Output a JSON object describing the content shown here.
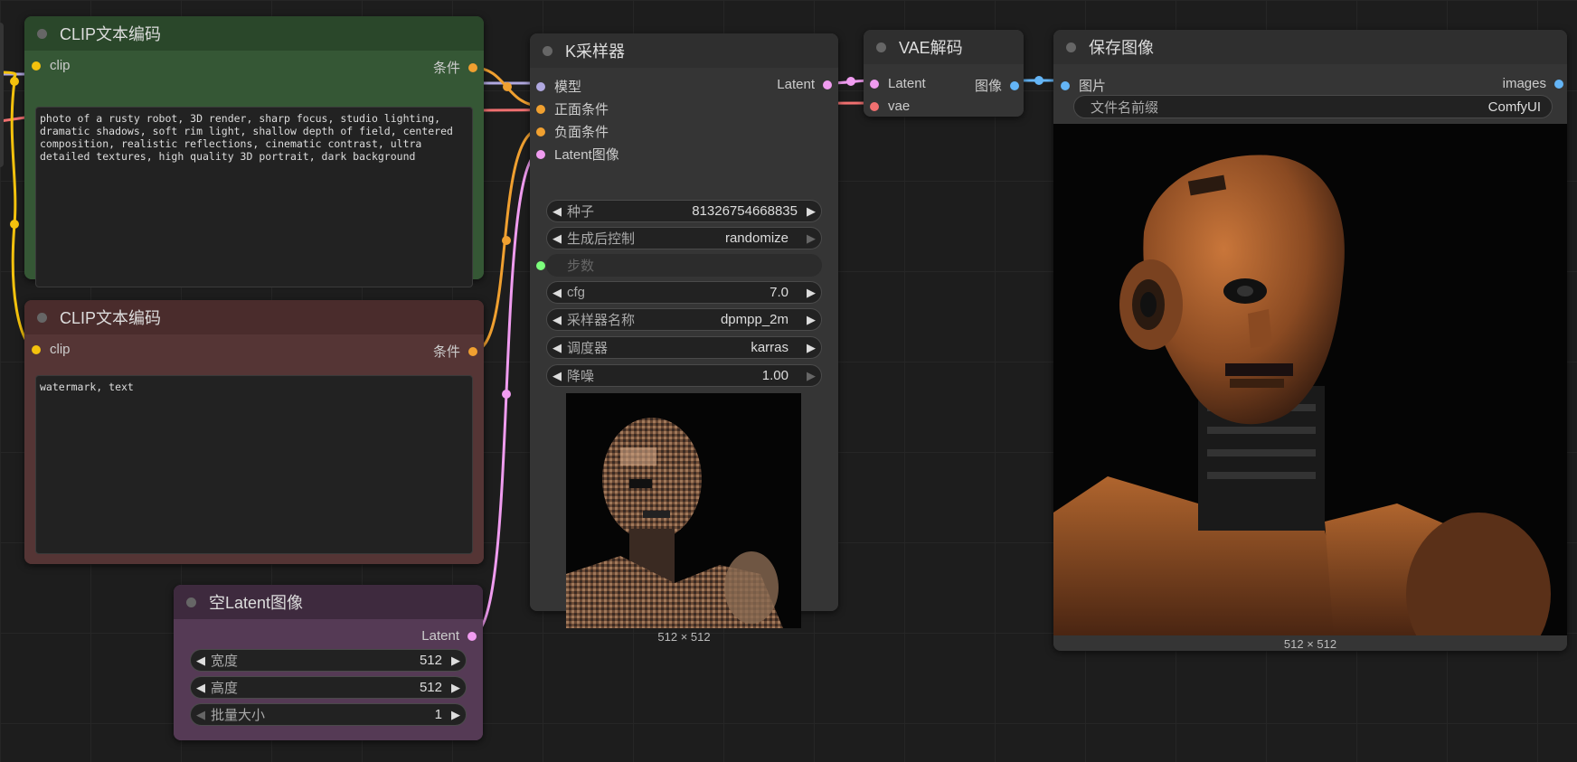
{
  "colors": {
    "clip_pin": "#f4c20d",
    "cond_pin": "#f0a030",
    "latent_pin": "#f09cf0",
    "model_pin": "#b0a8e0",
    "vae_pin": "#f07070",
    "image_pin": "#64b5f6",
    "int_pin": "#7cff7c"
  },
  "clip_pos": {
    "title": "CLIP文本编码",
    "input_clip": "clip",
    "output_cond": "条件",
    "text": "photo of a rusty robot, 3D render, sharp focus, studio lighting,\ndramatic shadows, soft rim light, shallow depth of field, centered\ncomposition, realistic reflections, cinematic contrast, ultra\ndetailed textures, high quality 3D portrait, dark background"
  },
  "clip_neg": {
    "title": "CLIP文本编码",
    "input_clip": "clip",
    "output_cond": "条件",
    "text": "watermark, text"
  },
  "empty_latent": {
    "title": "空Latent图像",
    "output_latent": "Latent",
    "width_label": "宽度",
    "width_value": "512",
    "height_label": "高度",
    "height_value": "512",
    "batch_label": "批量大小",
    "batch_value": "1"
  },
  "ksampler": {
    "title": "K采样器",
    "input_model": "模型",
    "input_positive": "正面条件",
    "input_negative": "负面条件",
    "input_latent": "Latent图像",
    "output_latent": "Latent",
    "seed_label": "种子",
    "seed_value": "81326754668835",
    "control_label": "生成后控制",
    "control_value": "randomize",
    "steps_label": "步数",
    "cfg_label": "cfg",
    "cfg_value": "7.0",
    "sampler_label": "采样器名称",
    "sampler_value": "dpmpp_2m",
    "scheduler_label": "调度器",
    "scheduler_value": "karras",
    "denoise_label": "降噪",
    "denoise_value": "1.00",
    "preview_size": "512 × 512"
  },
  "vae_decode": {
    "title": "VAE解码",
    "input_latent": "Latent",
    "input_vae": "vae",
    "output_image": "图像"
  },
  "save_image": {
    "title": "保存图像",
    "input_images": "图片",
    "output_images": "images",
    "prefix_label": "文件名前缀",
    "prefix_value": "ComfyUI",
    "preview_size": "512 × 512"
  }
}
